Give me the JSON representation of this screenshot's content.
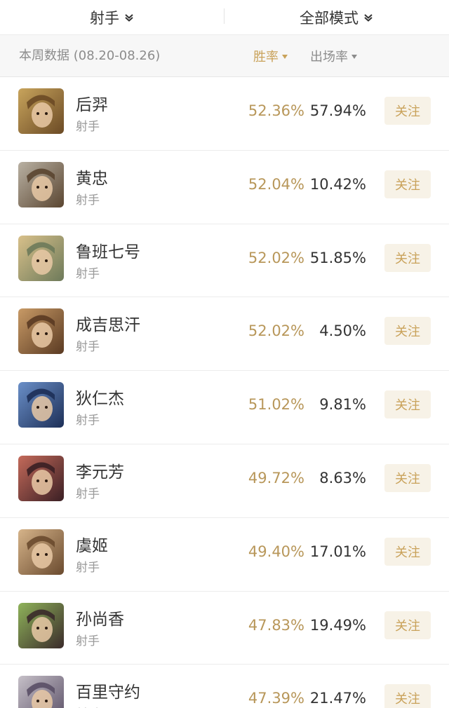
{
  "header": {
    "role_filter": "射手",
    "mode_filter": "全部模式"
  },
  "subheader": {
    "period": "本周数据 (08.20-08.26)",
    "sort_win_rate": "胜率",
    "sort_pick_rate": "出场率"
  },
  "colors": {
    "accent_gold": "#c9a25a",
    "win_rate_text": "#b8975a",
    "follow_bg": "#f7f2e7"
  },
  "heroes": [
    {
      "name": "后羿",
      "role": "射手",
      "win_rate": "52.36%",
      "pick_rate": "57.94%",
      "follow": "关注",
      "avatar_colors": [
        "#c8a45c",
        "#6b4a25"
      ]
    },
    {
      "name": "黄忠",
      "role": "射手",
      "win_rate": "52.04%",
      "pick_rate": "10.42%",
      "follow": "关注",
      "avatar_colors": [
        "#b9b1a3",
        "#5a4530"
      ]
    },
    {
      "name": "鲁班七号",
      "role": "射手",
      "win_rate": "52.02%",
      "pick_rate": "51.85%",
      "follow": "关注",
      "avatar_colors": [
        "#d8c08a",
        "#6d7a5a"
      ]
    },
    {
      "name": "成吉思汗",
      "role": "射手",
      "win_rate": "52.02%",
      "pick_rate": "4.50%",
      "follow": "关注",
      "avatar_colors": [
        "#c89a66",
        "#5a3a22"
      ]
    },
    {
      "name": "狄仁杰",
      "role": "射手",
      "win_rate": "51.02%",
      "pick_rate": "9.81%",
      "follow": "关注",
      "avatar_colors": [
        "#6a8fc8",
        "#1d2f57"
      ]
    },
    {
      "name": "李元芳",
      "role": "射手",
      "win_rate": "49.72%",
      "pick_rate": "8.63%",
      "follow": "关注",
      "avatar_colors": [
        "#c46a5a",
        "#3a1f24"
      ]
    },
    {
      "name": "虞姬",
      "role": "射手",
      "win_rate": "49.40%",
      "pick_rate": "17.01%",
      "follow": "关注",
      "avatar_colors": [
        "#d6b48a",
        "#6a4a2e"
      ]
    },
    {
      "name": "孙尚香",
      "role": "射手",
      "win_rate": "47.83%",
      "pick_rate": "19.49%",
      "follow": "关注",
      "avatar_colors": [
        "#8fb35a",
        "#3a2a2a"
      ]
    },
    {
      "name": "百里守约",
      "role": "射手",
      "win_rate": "47.39%",
      "pick_rate": "21.47%",
      "follow": "关注",
      "avatar_colors": [
        "#c6c0c8",
        "#5a4f66"
      ]
    }
  ]
}
